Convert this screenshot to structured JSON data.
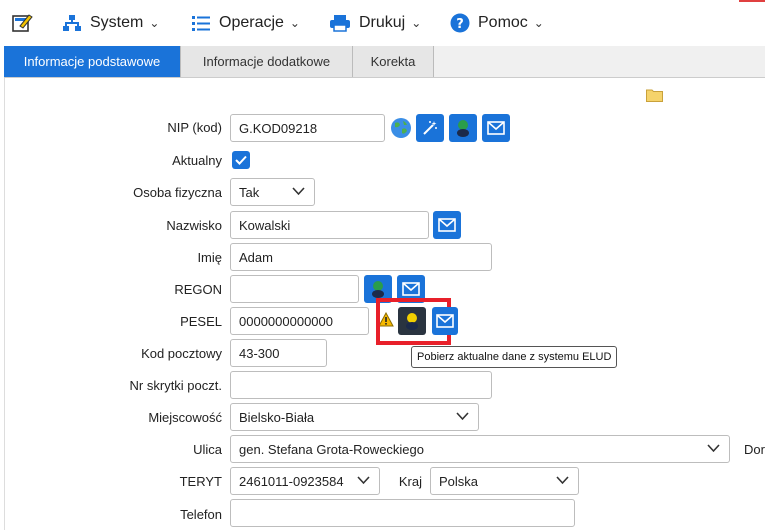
{
  "menu": {
    "system": "System",
    "operacje": "Operacje",
    "drukuj": "Drukuj",
    "pomoc": "Pomoc"
  },
  "tabs": [
    {
      "label": "Informacje podstawowe",
      "active": true
    },
    {
      "label": "Informacje dodatkowe",
      "active": false
    },
    {
      "label": "Korekta",
      "active": false
    }
  ],
  "form": {
    "nip_label": "NIP (kod)",
    "nip_value": "G.KOD09218",
    "aktualny_label": "Aktualny",
    "aktualny_checked": true,
    "osoba_label": "Osoba fizyczna",
    "osoba_value": "Tak",
    "nazwisko_label": "Nazwisko",
    "nazwisko_value": "Kowalski",
    "imie_label": "Imię",
    "imie_value": "Adam",
    "regon_label": "REGON",
    "regon_value": "",
    "pesel_label": "PESEL",
    "pesel_value": "0000000000000",
    "kod_label": "Kod pocztowy",
    "kod_value": "43-300",
    "skrytka_label": "Nr skrytki poczt.",
    "skrytka_value": "",
    "miejscowosc_label": "Miejscowość",
    "miejscowosc_value": "Bielsko-Biała",
    "ulica_label": "Ulica",
    "ulica_value": "gen. Stefana Grota-Roweckiego",
    "dom_label": "Dor",
    "teryt_label": "TERYT",
    "teryt_value": "2461011-0923584",
    "kraj_label": "Kraj",
    "kraj_value": "Polska",
    "telefon_label": "Telefon",
    "telefon_value": ""
  },
  "tooltip": "Pobierz aktualne dane z systemu ELUD",
  "colors": {
    "accent": "#1a73d9",
    "highlight": "#e8202a",
    "warning": "#f5b800"
  }
}
